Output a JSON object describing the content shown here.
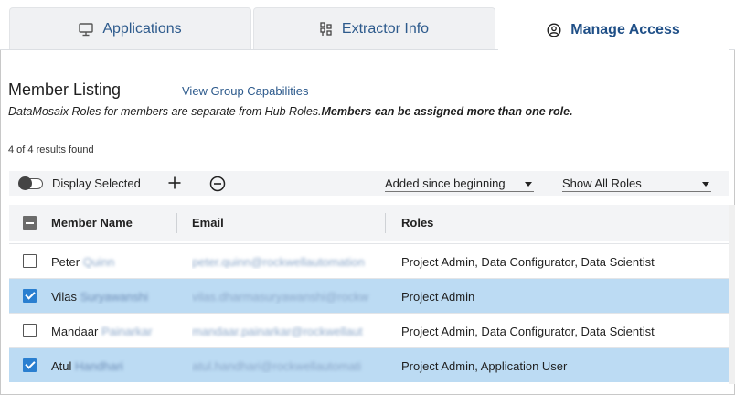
{
  "tabs": [
    {
      "label": "Applications",
      "icon": "monitor-icon",
      "active": false
    },
    {
      "label": "Extractor Info",
      "icon": "extractor-icon",
      "active": false
    },
    {
      "label": "Manage Access",
      "icon": "user-circle-icon",
      "active": true
    }
  ],
  "header": {
    "title": "Member Listing",
    "link": "View Group Capabilities",
    "subtitle_italic": "DataMosaix Roles for members are separate from Hub Roles.",
    "subtitle_bold": "Members can be assigned more than one role.",
    "results": "4 of 4 results found"
  },
  "toolbar": {
    "display_selected": "Display Selected",
    "toggle_on": false,
    "filter_added": "Added since beginning",
    "filter_roles": "Show All Roles"
  },
  "table": {
    "columns": [
      "Member Name",
      "Email",
      "Roles"
    ],
    "rows": [
      {
        "selected": false,
        "first": "Peter",
        "last": "Quinn",
        "email": "peter.quinn@rockwellautomation",
        "roles": "Project Admin, Data Configurator, Data Scientist"
      },
      {
        "selected": true,
        "first": "Vilas",
        "last": "Suryawanshi",
        "email": "vilas.dharmasuryawanshi@rockw",
        "roles": "Project Admin"
      },
      {
        "selected": false,
        "first": "Mandaar",
        "last": "Painarkar",
        "email": "mandaar.painarkar@rockwellaut",
        "roles": "Project Admin, Data Configurator, Data Scientist"
      },
      {
        "selected": true,
        "first": "Atul",
        "last": "Handhari",
        "email": "atul.handhari@rockwellautomati",
        "roles": "Project Admin, Application User"
      }
    ]
  },
  "colors": {
    "accent": "#2d5a8c",
    "selected_row": "#bcdbf3",
    "checkbox": "#2a7fd0"
  }
}
